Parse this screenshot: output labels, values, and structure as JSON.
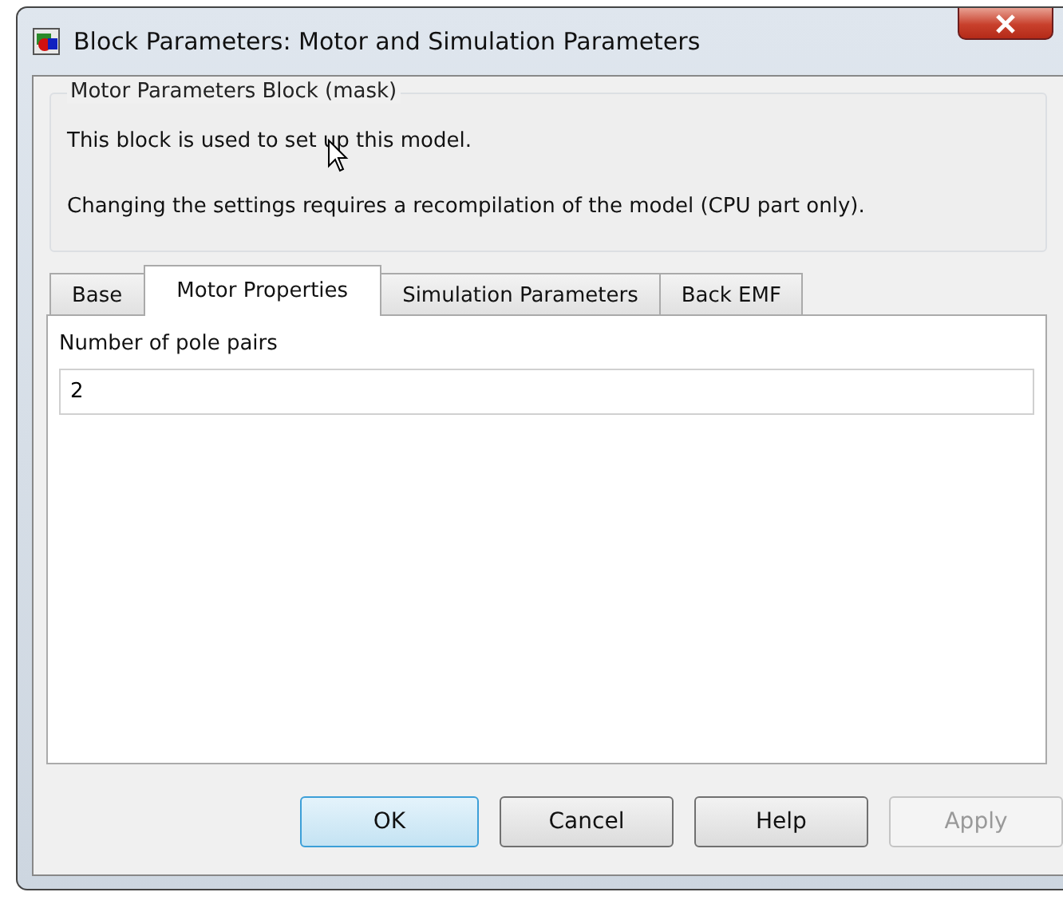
{
  "window": {
    "title": "Block Parameters: Motor and Simulation Parameters"
  },
  "description": {
    "group_title": "Motor Parameters Block (mask)",
    "lines": [
      "This block is used to set up this model.",
      "Changing the settings requires a recompilation of the model (CPU part only)."
    ]
  },
  "tabs": [
    {
      "label": "Base",
      "selected": false
    },
    {
      "label": "Motor Properties",
      "selected": true
    },
    {
      "label": "Simulation Parameters",
      "selected": false
    },
    {
      "label": "Back EMF",
      "selected": false
    }
  ],
  "fields": [
    {
      "label": "Number of pole pairs",
      "value": "2"
    }
  ],
  "buttons": [
    {
      "label": "OK",
      "default": true,
      "disabled": false
    },
    {
      "label": "Cancel",
      "default": false,
      "disabled": false
    },
    {
      "label": "Help",
      "default": false,
      "disabled": false
    },
    {
      "label": "Apply",
      "default": false,
      "disabled": true
    }
  ]
}
